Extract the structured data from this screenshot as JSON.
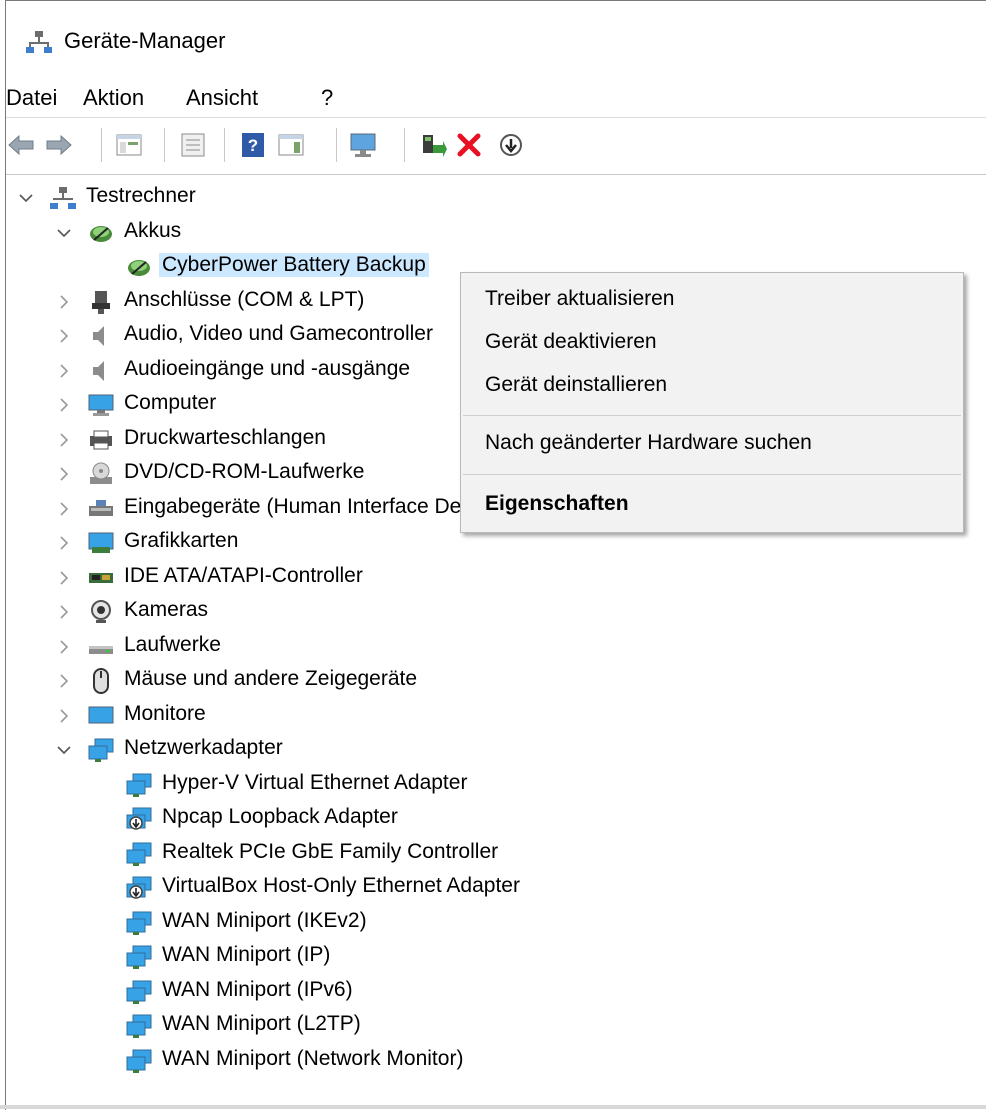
{
  "window": {
    "title": "Geräte-Manager"
  },
  "menu": [
    "Datei",
    "Aktion",
    "Ansicht",
    "?"
  ],
  "toolbar": [
    {
      "name": "back",
      "icon": "back-arrow-icon"
    },
    {
      "name": "forward",
      "icon": "forward-arrow-icon"
    },
    {
      "name": "show-hide-console-tree",
      "icon": "console-tree-icon"
    },
    {
      "name": "properties",
      "icon": "properties-icon"
    },
    {
      "name": "help",
      "icon": "help-icon"
    },
    {
      "name": "action-pane",
      "icon": "action-pane-icon"
    },
    {
      "name": "scan-hardware",
      "icon": "monitor-scan-icon"
    },
    {
      "name": "update-driver",
      "icon": "update-driver-icon"
    },
    {
      "name": "uninstall",
      "icon": "red-x-icon"
    },
    {
      "name": "disable",
      "icon": "down-arrow-circle-icon"
    }
  ],
  "tree": {
    "root": "Testrechner",
    "nodes": [
      {
        "label": "Akkus",
        "icon": "battery-icon",
        "expanded": true,
        "children": [
          {
            "label": "CyberPower Battery Backup",
            "icon": "battery-icon",
            "selected": true
          }
        ]
      },
      {
        "label": "Anschlüsse (COM & LPT)",
        "icon": "port-icon"
      },
      {
        "label": "Audio, Video und Gamecontroller",
        "icon": "speaker-icon"
      },
      {
        "label": "Audioeingänge und -ausgänge",
        "icon": "speaker-icon"
      },
      {
        "label": "Computer",
        "icon": "computer-icon"
      },
      {
        "label": "Druckwarteschlangen",
        "icon": "printer-icon"
      },
      {
        "label": "DVD/CD-ROM-Laufwerke",
        "icon": "dvd-icon"
      },
      {
        "label": "Eingabegeräte (Human Interface Devices)",
        "icon": "hid-icon"
      },
      {
        "label": "Grafikkarten",
        "icon": "display-adapter-icon"
      },
      {
        "label": "IDE ATA/ATAPI-Controller",
        "icon": "ide-controller-icon"
      },
      {
        "label": "Kameras",
        "icon": "camera-icon"
      },
      {
        "label": "Laufwerke",
        "icon": "drive-icon"
      },
      {
        "label": "Mäuse und andere Zeigegeräte",
        "icon": "mouse-icon"
      },
      {
        "label": "Monitore",
        "icon": "monitor-icon"
      },
      {
        "label": "Netzwerkadapter",
        "icon": "network-adapter-icon",
        "expanded": true,
        "children": [
          {
            "label": "Hyper-V Virtual Ethernet Adapter",
            "icon": "network-adapter-icon"
          },
          {
            "label": "Npcap Loopback Adapter",
            "icon": "network-adapter-disabled-icon"
          },
          {
            "label": "Realtek PCIe GbE Family Controller",
            "icon": "network-adapter-icon"
          },
          {
            "label": "VirtualBox Host-Only Ethernet Adapter",
            "icon": "network-adapter-disabled-icon"
          },
          {
            "label": "WAN Miniport (IKEv2)",
            "icon": "network-adapter-icon"
          },
          {
            "label": "WAN Miniport (IP)",
            "icon": "network-adapter-icon"
          },
          {
            "label": "WAN Miniport (IPv6)",
            "icon": "network-adapter-icon"
          },
          {
            "label": "WAN Miniport (L2TP)",
            "icon": "network-adapter-icon"
          },
          {
            "label": "WAN Miniport (Network Monitor)",
            "icon": "network-adapter-icon"
          }
        ]
      }
    ]
  },
  "context_menu": {
    "items": [
      {
        "label": "Treiber aktualisieren"
      },
      {
        "label": "Gerät deaktivieren"
      },
      {
        "label": "Gerät deinstallieren"
      },
      {
        "separator": true
      },
      {
        "label": "Nach geänderter Hardware suchen"
      },
      {
        "separator": true
      },
      {
        "label": "Eigenschaften",
        "bold": true
      }
    ]
  },
  "colors": {
    "selection": "#cce8ff",
    "menu_bg": "#f2f2f2",
    "delete_red": "#e81123"
  }
}
